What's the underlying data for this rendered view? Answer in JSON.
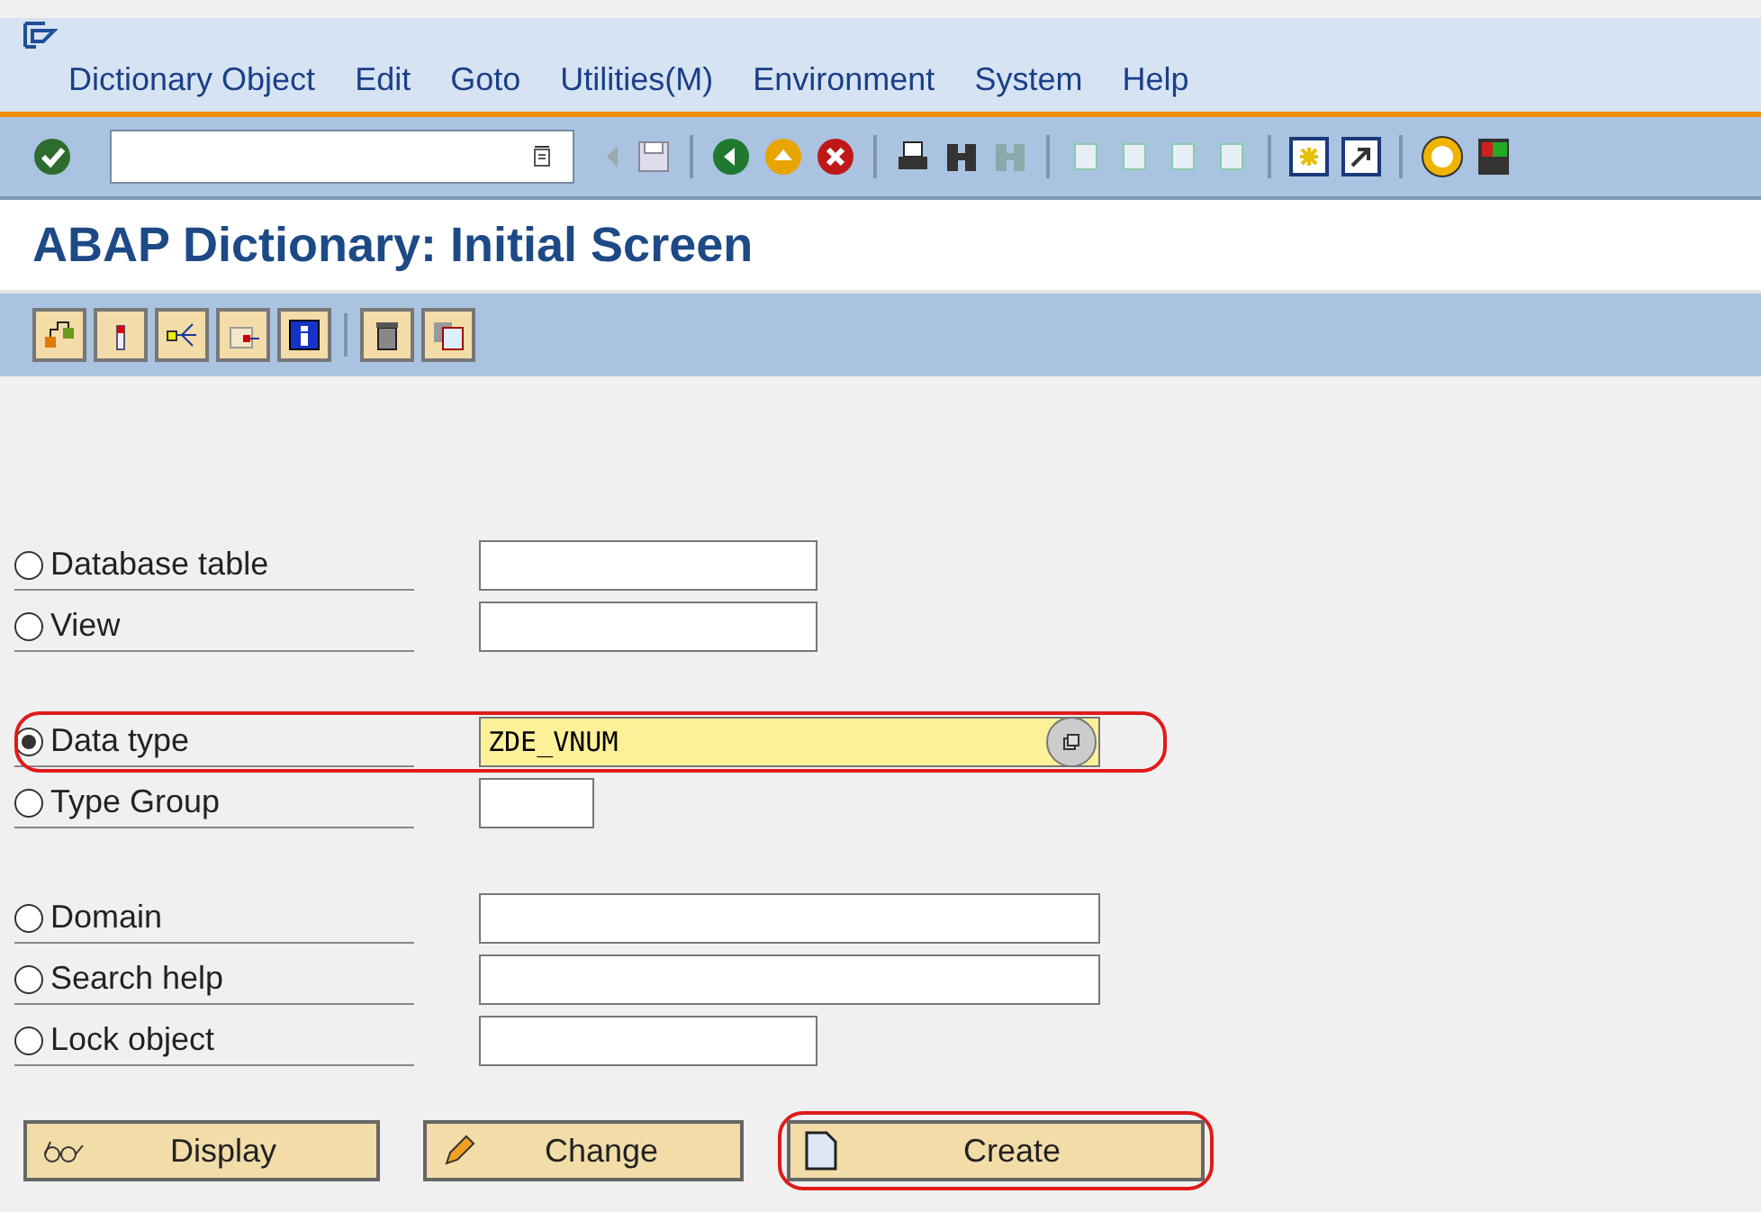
{
  "menu": [
    "Dictionary Object",
    "Edit",
    "Goto",
    "Utilities(M)",
    "Environment",
    "System",
    "Help"
  ],
  "title": "ABAP Dictionary: Initial Screen",
  "object_groups": [
    [
      {
        "label": "Database table",
        "selected": false,
        "highlighted": false
      },
      {
        "label": "View",
        "selected": false,
        "highlighted": false
      }
    ],
    [
      {
        "label": "Data type",
        "selected": true,
        "value": "ZDE_VNUM",
        "highlighted": true
      },
      {
        "label": "Type Group",
        "selected": false,
        "highlighted": false
      }
    ],
    [
      {
        "label": "Domain",
        "selected": false,
        "highlighted": false
      },
      {
        "label": "Search help",
        "selected": false,
        "highlighted": false
      },
      {
        "label": "Lock object",
        "selected": false,
        "highlighted": false
      }
    ]
  ],
  "buttons": [
    {
      "kind": "display",
      "label": "Display",
      "highlighted": false
    },
    {
      "kind": "change",
      "label": "Change",
      "highlighted": false
    },
    {
      "kind": "create",
      "label": "Create",
      "highlighted": true
    }
  ]
}
